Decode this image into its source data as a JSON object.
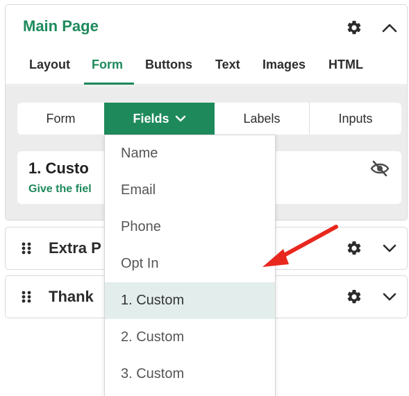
{
  "main_panel": {
    "title": "Main Page",
    "tabs": [
      "Layout",
      "Form",
      "Buttons",
      "Text",
      "Images",
      "HTML"
    ],
    "active_tab": "Form",
    "subtabs": [
      "Form",
      "Fields",
      "Labels",
      "Inputs"
    ],
    "active_subtab": "Fields",
    "field_card": {
      "title": "1. Custo",
      "subtitle": "Give the fiel"
    }
  },
  "collapsed_panels": [
    {
      "title": "Extra P"
    },
    {
      "title": "Thank"
    }
  ],
  "dropdown": {
    "items": [
      "Name",
      "Email",
      "Phone",
      "Opt In",
      "1. Custom",
      "2. Custom",
      "3. Custom"
    ],
    "selected": "1. Custom"
  },
  "icons": {
    "header": [
      "gear-icon",
      "chevron-up-icon"
    ],
    "field_card": "eye-slash-icon",
    "collapsed": [
      "drag-handle-icon",
      "gear-icon",
      "chevron-down-icon"
    ]
  },
  "colors": {
    "accent": "#1e8a5c",
    "selected_row": "#e3eeec",
    "body_bg": "#ececec",
    "annotation_arrow": "#e8281e"
  }
}
